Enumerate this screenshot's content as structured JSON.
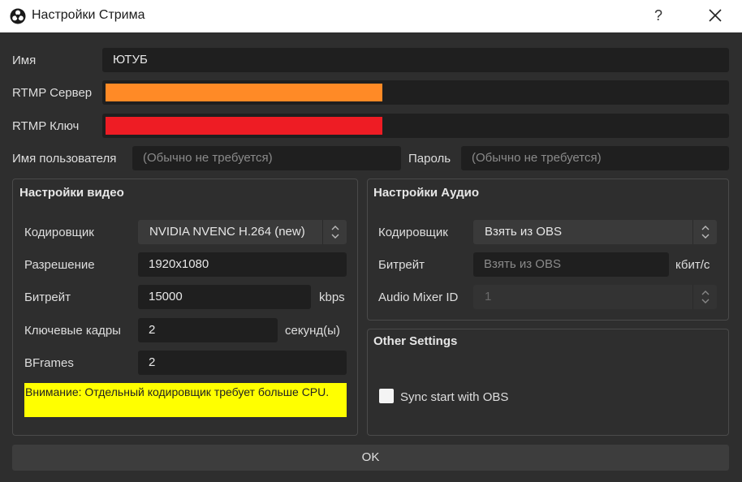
{
  "window": {
    "title": "Настройки Стрима",
    "help_label": "?"
  },
  "form": {
    "name_label": "Имя",
    "name_value": "ЮТУБ",
    "server_label": "RTMP Сервер",
    "key_label": "RTMP Ключ",
    "username_label": "Имя пользователя",
    "username_placeholder": "(Обычно не требуется)",
    "password_label": "Пароль",
    "password_placeholder": "(Обычно не требуется)"
  },
  "redaction_colors": {
    "server": "#ff8a26",
    "key": "#ee1c24"
  },
  "video": {
    "title": "Настройки видео",
    "encoder_label": "Кодировщик",
    "encoder_value": "NVIDIA NVENC H.264 (new)",
    "resolution_label": "Разрешение",
    "resolution_value": "1920x1080",
    "bitrate_label": "Битрейт",
    "bitrate_value": "15000",
    "bitrate_unit": "kbps",
    "keyframes_label": "Ключевые кадры",
    "keyframes_value": "2",
    "keyframes_unit": "секунд(ы)",
    "bframes_label": "BFrames",
    "bframes_value": "2",
    "warning": "Внимание: Отдельный кодировщик требует больше CPU."
  },
  "audio": {
    "title": "Настройки Аудио",
    "encoder_label": "Кодировщик",
    "encoder_value": "Взять из OBS",
    "bitrate_label": "Битрейт",
    "bitrate_value": "Взять из OBS",
    "bitrate_unit": "кбит/с",
    "mixer_label": "Audio Mixer ID",
    "mixer_value": "1"
  },
  "other": {
    "title": "Other Settings",
    "sync_label": "Sync start with OBS",
    "sync_checked": false
  },
  "actions": {
    "ok_label": "OK"
  },
  "warning_color": "#ffff00"
}
